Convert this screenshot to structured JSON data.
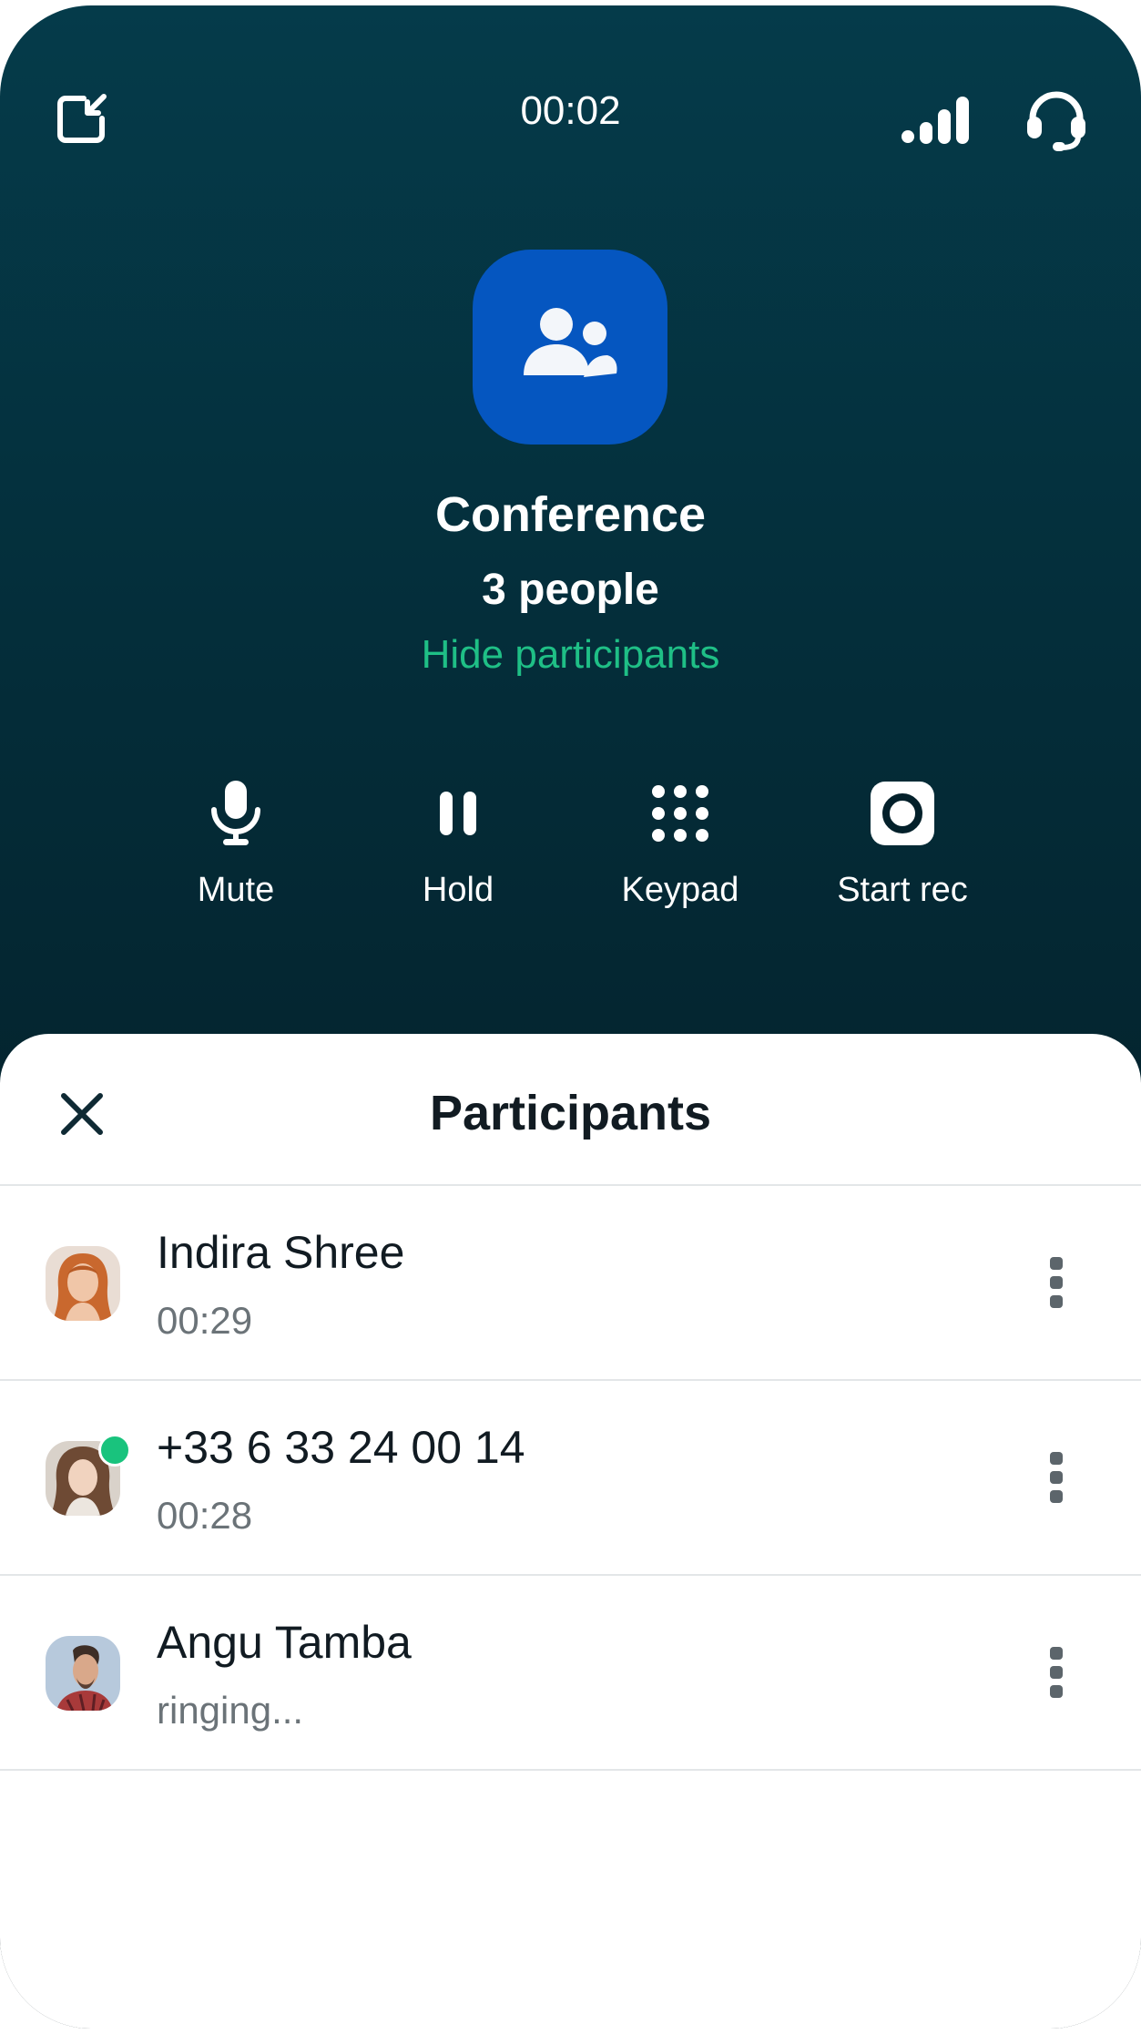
{
  "call": {
    "timer": "00:02",
    "title": "Conference",
    "count": "3 people",
    "toggle_label": "Hide participants"
  },
  "icons": {
    "minimize": "minimize-window-icon",
    "signal": "signal-strength-icon",
    "headset": "headset-icon",
    "group": "group-icon",
    "close": "close-icon",
    "more": "more-vertical-icon"
  },
  "controls": [
    {
      "label": "Mute",
      "icon": "microphone-icon"
    },
    {
      "label": "Hold",
      "icon": "pause-icon"
    },
    {
      "label": "Keypad",
      "icon": "keypad-icon"
    },
    {
      "label": "Start rec",
      "icon": "record-icon"
    }
  ],
  "sheet": {
    "title": "Participants"
  },
  "participants": [
    {
      "name": "Indira Shree",
      "status": "00:29",
      "online": false
    },
    {
      "name": "+33 6 33 24 00 14",
      "status": "00:28",
      "online": true
    },
    {
      "name": "Angu Tamba",
      "status": "ringing...",
      "online": false
    }
  ],
  "colors": {
    "accent_green": "#1fbf86",
    "conference_blue": "#0556c0",
    "online_dot": "#19c37d",
    "background_top": "#053b4a",
    "background_bottom": "#02141b"
  }
}
